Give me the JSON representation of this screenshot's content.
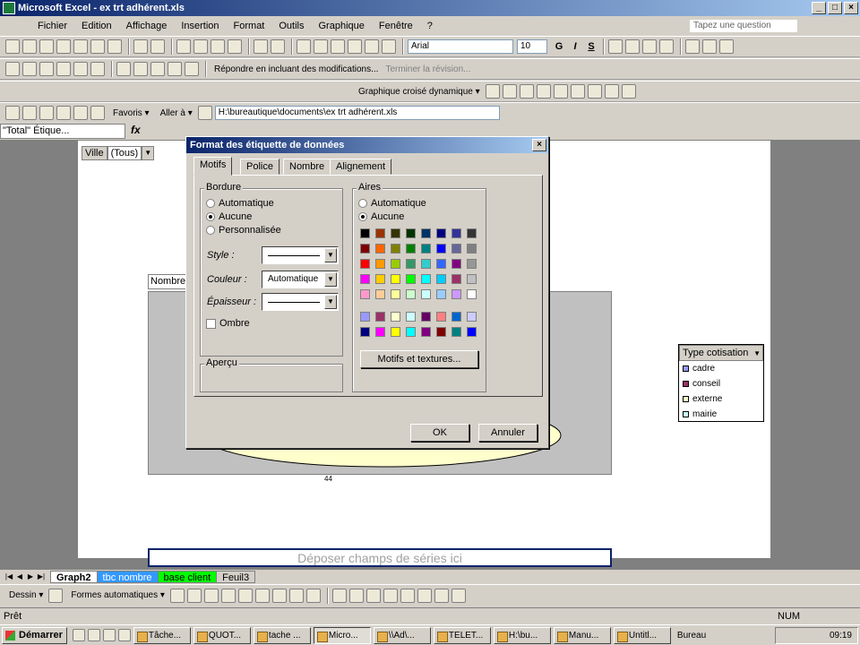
{
  "app": {
    "title": "Microsoft Excel - ex trt adhérent.xls"
  },
  "menu": [
    "Fichier",
    "Edition",
    "Affichage",
    "Insertion",
    "Format",
    "Outils",
    "Graphique",
    "Fenêtre",
    "?"
  ],
  "help_placeholder": "Tapez une question",
  "toolbar": {
    "font": "Arial",
    "size": "10",
    "bold": "G",
    "italic": "I",
    "shadow": "S",
    "reviewing_reply": "Répondre en incluant des modifications...",
    "reviewing_end": "Terminer la révision...",
    "pivot_chart": "Graphique croisé dynamique ▾"
  },
  "web": {
    "favoris": "Favoris ▾",
    "aller": "Aller à ▾",
    "address": "H:\\bureautique\\documents\\ex trt adhérent.xls"
  },
  "formula": {
    "namebox": "\"Total\" Étique...",
    "fx": "fx"
  },
  "chart": {
    "page_field_name": "Ville",
    "page_field_value": "(Tous)",
    "data_field": "Nombre de",
    "legend_title": "Type cotisation",
    "legend": [
      {
        "label": "cadre",
        "color": "#9999ff"
      },
      {
        "label": "conseil",
        "color": "#993366"
      },
      {
        "label": "externe",
        "color": "#ffffcc"
      },
      {
        "label": "mairie",
        "color": "#ccffff"
      }
    ],
    "drop_series": "Déposer champs de séries ici",
    "value_label": "44"
  },
  "dialog": {
    "title": "Format des étiquette de données",
    "tabs": [
      "Motifs",
      "Police",
      "Nombre",
      "Alignement"
    ],
    "border_group": "Bordure",
    "border_auto": "Automatique",
    "border_none": "Aucune",
    "border_custom": "Personnalisée",
    "style_label": "Style :",
    "color_label": "Couleur :",
    "color_value": "Automatique",
    "thickness_label": "Épaisseur :",
    "shadow_label": "Ombre",
    "preview_group": "Aperçu",
    "area_group": "Aires",
    "area_auto": "Automatique",
    "area_none": "Aucune",
    "patterns_btn": "Motifs et textures...",
    "ok": "OK",
    "cancel": "Annuler",
    "palette": [
      [
        "#000000",
        "#993300",
        "#333300",
        "#003300",
        "#003366",
        "#000080",
        "#333399",
        "#333333"
      ],
      [
        "#800000",
        "#ff6600",
        "#808000",
        "#008000",
        "#008080",
        "#0000ff",
        "#666699",
        "#808080"
      ],
      [
        "#ff0000",
        "#ff9900",
        "#99cc00",
        "#339966",
        "#33cccc",
        "#3366ff",
        "#800080",
        "#969696"
      ],
      [
        "#ff00ff",
        "#ffcc00",
        "#ffff00",
        "#00ff00",
        "#00ffff",
        "#00ccff",
        "#993366",
        "#c0c0c0"
      ],
      [
        "#ff99cc",
        "#ffcc99",
        "#ffff99",
        "#ccffcc",
        "#ccffff",
        "#99ccff",
        "#cc99ff",
        "#ffffff"
      ],
      [
        "#9999ff",
        "#993366",
        "#ffffcc",
        "#ccffff",
        "#660066",
        "#ff8080",
        "#0066cc",
        "#ccccff"
      ],
      [
        "#000080",
        "#ff00ff",
        "#ffff00",
        "#00ffff",
        "#800080",
        "#800000",
        "#008080",
        "#0000ff"
      ]
    ]
  },
  "sheets": [
    {
      "label": "Graph2",
      "color": "#ffffff"
    },
    {
      "label": "tbc nombre",
      "color": "#3399ff"
    },
    {
      "label": "base client",
      "color": "#00ff00"
    },
    {
      "label": "Feuil3",
      "color": "#d4d0c8"
    }
  ],
  "drawing": {
    "dessin": "Dessin ▾",
    "formes": "Formes automatiques ▾"
  },
  "status": {
    "left": "Prêt",
    "num": "NUM"
  },
  "taskbar": {
    "start": "Démarrer",
    "tasks": [
      "Tâche...",
      "QUOT...",
      "tache ...",
      "Micro...",
      "\\\\Ad\\...",
      "TELET...",
      "H:\\bu...",
      "Manu...",
      "Untitl..."
    ],
    "active_index": 3,
    "bureau": "Bureau",
    "clock": "09:19"
  }
}
